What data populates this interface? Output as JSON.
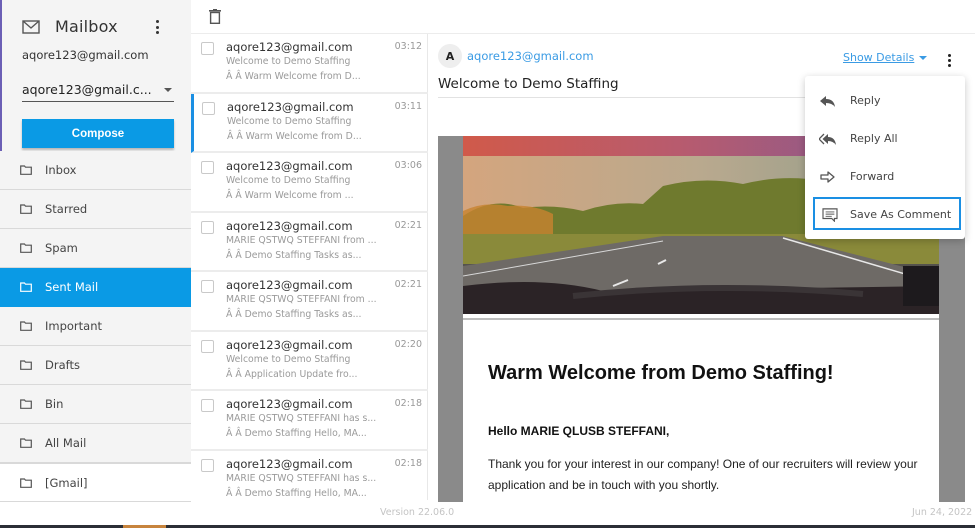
{
  "sidebar": {
    "title": "Mailbox",
    "account_email": "aqore123@gmail.com",
    "account_select_value": "aqore123@gmail.c...",
    "compose_label": "Compose",
    "folders": [
      {
        "label": "Inbox",
        "icon": "folder-icon"
      },
      {
        "label": "Starred",
        "icon": "folder-icon"
      },
      {
        "label": "Spam",
        "icon": "folder-icon"
      },
      {
        "label": "Sent Mail",
        "icon": "folder-icon",
        "active": true
      },
      {
        "label": "Important",
        "icon": "folder-icon"
      },
      {
        "label": "Drafts",
        "icon": "folder-icon"
      },
      {
        "label": "Bin",
        "icon": "folder-icon"
      },
      {
        "label": "All Mail",
        "icon": "folder-icon"
      },
      {
        "label": "[Gmail]",
        "icon": "folder-icon"
      }
    ]
  },
  "toolbar": {
    "delete_icon": "trash-icon"
  },
  "messages": [
    {
      "from": "aqore123@gmail.com",
      "time": "03:12",
      "subject": "Welcome to Demo Staffing",
      "preview": "Â  Â  Warm Welcome from D..."
    },
    {
      "from": "aqore123@gmail.com",
      "time": "03:11",
      "subject": "Welcome to Demo Staffing",
      "preview": "Â  Â  Warm Welcome from D...",
      "selected": true
    },
    {
      "from": "aqore123@gmail.com",
      "time": "03:06",
      "subject": "Welcome to Demo Staffing",
      "preview": "Â  Â  Warm Welcome from ..."
    },
    {
      "from": "aqore123@gmail.com",
      "time": "02:21",
      "subject": "MARIE QSTWQ STEFFANI from ...",
      "preview": "Â  Â  Demo Staffing Tasks as..."
    },
    {
      "from": "aqore123@gmail.com",
      "time": "02:21",
      "subject": "MARIE QSTWQ STEFFANI from ...",
      "preview": "Â  Â  Demo Staffing Tasks as..."
    },
    {
      "from": "aqore123@gmail.com",
      "time": "02:20",
      "subject": "Welcome to Demo Staffing",
      "preview": "Â  Â  Application Update fro..."
    },
    {
      "from": "aqore123@gmail.com",
      "time": "02:18",
      "subject": "MARIE QSTWQ STEFFANI has s...",
      "preview": "Â  Â  Demo Staffing Hello, MA..."
    },
    {
      "from": "aqore123@gmail.com",
      "time": "02:18",
      "subject": "MARIE QSTWQ STEFFANI has s...",
      "preview": "Â  Â  Demo Staffing Hello, MA..."
    }
  ],
  "reader": {
    "avatar_letter": "A",
    "sender": "aqore123@gmail.com",
    "subject": "Welcome to Demo Staffing",
    "show_details_label": "Show Details",
    "email_body": {
      "heading": "Warm Welcome from Demo Staffing!",
      "greeting": "Hello MARIE QLUSB STEFFANI,",
      "paragraph": "Thank you for your interest in our company! One of our recruiters will review your application and be in touch with you shortly."
    }
  },
  "menu": {
    "items": [
      {
        "label": "Reply",
        "icon": "reply-icon"
      },
      {
        "label": "Reply All",
        "icon": "reply-all-icon"
      },
      {
        "label": "Forward",
        "icon": "forward-icon"
      },
      {
        "label": "Save As Comment",
        "icon": "comment-icon",
        "focused": true
      }
    ]
  },
  "footer": {
    "version": "Version 22.06.0",
    "date": "Jun 24, 2022"
  },
  "colors": {
    "accent": "#0a9ae5",
    "link": "#3a9be4",
    "focus_border": "#1a8fe3"
  }
}
